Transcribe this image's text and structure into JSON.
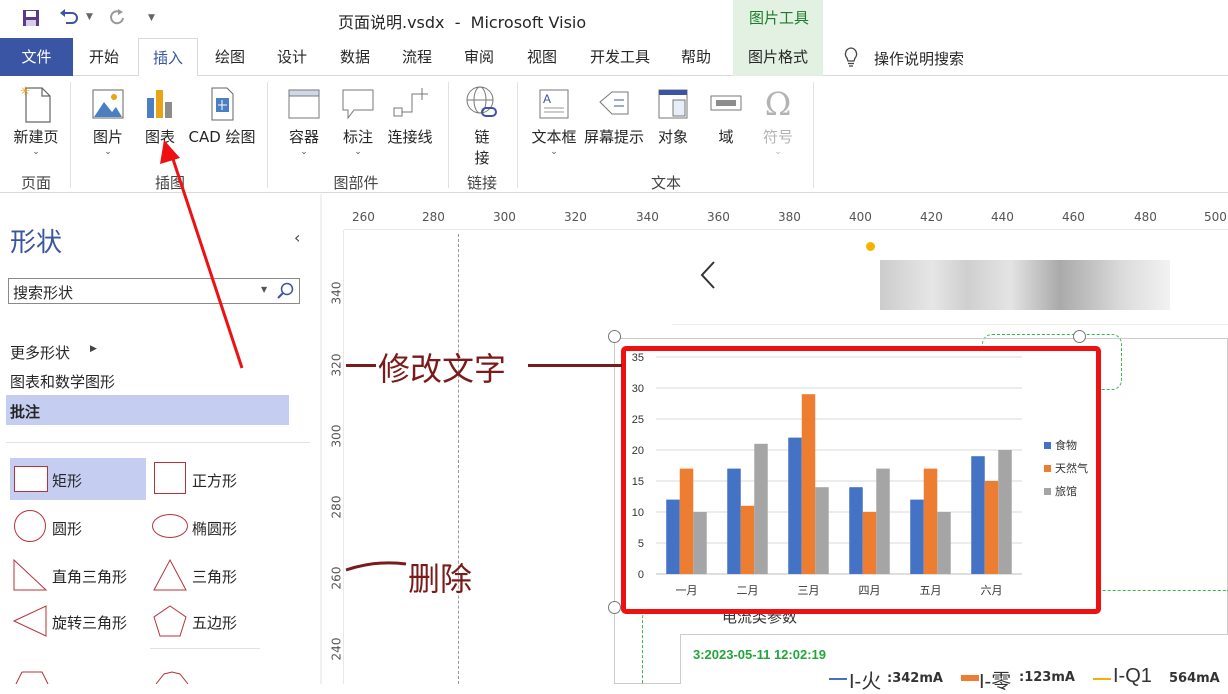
{
  "titlebar": {
    "title": "页面说明.vsdx  -  Microsoft Visio",
    "context_group": "图片工具"
  },
  "tabs": [
    "文件",
    "开始",
    "插入",
    "绘图",
    "设计",
    "数据",
    "流程",
    "审阅",
    "视图",
    "开发工具",
    "帮助",
    "图片格式"
  ],
  "search_label": "操作说明搜索",
  "ribbon": {
    "new_page": "新建页",
    "picture": "图片",
    "chart": "图表",
    "cad": "CAD 绘图",
    "container": "容器",
    "callout": "标注",
    "connector": "连接线",
    "link_line1": "链",
    "link_line2": "接",
    "textbox": "文本框",
    "screentip": "屏幕提示",
    "object": "对象",
    "field": "域",
    "symbol": "符号",
    "groups": {
      "page": "页面",
      "illustration": "插图",
      "diagram_parts": "图部件",
      "links": "链接",
      "text": "文本"
    }
  },
  "shapes_panel": {
    "title": "形状",
    "search_value": "搜索形状",
    "more_shapes": "更多形状",
    "stencils": [
      "图表和数学图形",
      "批注"
    ],
    "items": [
      "矩形",
      "正方形",
      "圆形",
      "椭圆形",
      "直角三角形",
      "三角形",
      "旋转三角形",
      "五边形"
    ]
  },
  "rulers": {
    "h": [
      "260",
      "280",
      "300",
      "320",
      "340",
      "360",
      "380",
      "400",
      "420",
      "440",
      "460",
      "480",
      "500"
    ],
    "v": [
      "340",
      "320",
      "300",
      "280",
      "260",
      "240"
    ]
  },
  "annotations": {
    "edit_text": "修改文字",
    "delete": "删除"
  },
  "canvas_texts": {
    "partial_label": "电流类参数",
    "timestamp": "3:2023-05-11 12:02:19",
    "legend": [
      {
        "label": "I-火",
        "value": ":342mA"
      },
      {
        "label": "I-零",
        "value": ":123mA"
      },
      {
        "label": "I-Q1",
        "value": "564mA"
      }
    ]
  },
  "colors": {
    "file_tab": "#3955a3",
    "highlight": "#c5cdf0",
    "annotation": "#7b1a1a",
    "red_frame": "#ee1111"
  },
  "chart_data": {
    "type": "bar",
    "categories": [
      "一月",
      "二月",
      "三月",
      "四月",
      "五月",
      "六月"
    ],
    "series": [
      {
        "name": "食物",
        "color": "#4472c4",
        "values": [
          12,
          17,
          22,
          14,
          12,
          19
        ]
      },
      {
        "name": "天然气",
        "color": "#ed7d31",
        "values": [
          17,
          11,
          29,
          10,
          17,
          15
        ]
      },
      {
        "name": "旅馆",
        "color": "#a5a5a5",
        "values": [
          10,
          21,
          14,
          17,
          10,
          20
        ]
      }
    ],
    "ylim": [
      0,
      35
    ],
    "yticks": [
      "0",
      "5",
      "10",
      "15",
      "20",
      "25",
      "30",
      "35"
    ],
    "grid": true,
    "legend": "right"
  }
}
